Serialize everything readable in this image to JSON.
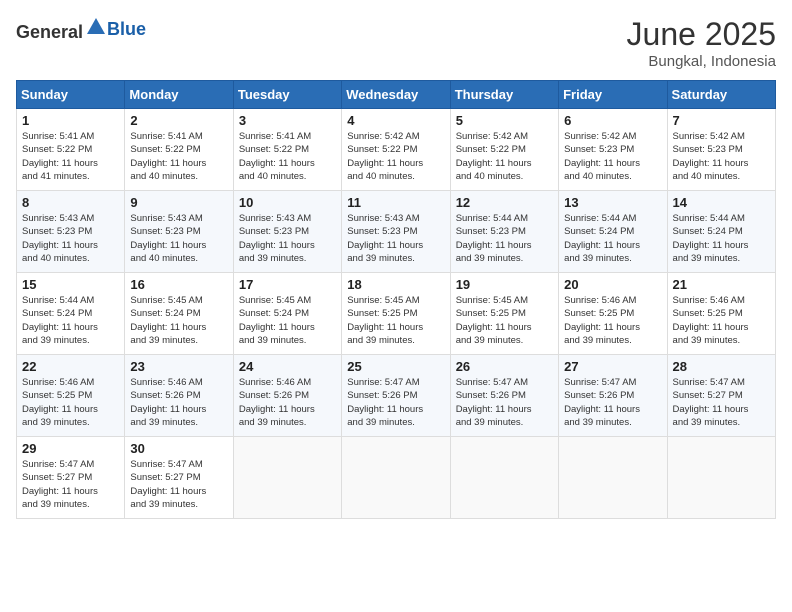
{
  "logo": {
    "general": "General",
    "blue": "Blue"
  },
  "title": "June 2025",
  "subtitle": "Bungkal, Indonesia",
  "headers": [
    "Sunday",
    "Monday",
    "Tuesday",
    "Wednesday",
    "Thursday",
    "Friday",
    "Saturday"
  ],
  "weeks": [
    [
      {
        "day": "1",
        "info": "Sunrise: 5:41 AM\nSunset: 5:22 PM\nDaylight: 11 hours\nand 41 minutes."
      },
      {
        "day": "2",
        "info": "Sunrise: 5:41 AM\nSunset: 5:22 PM\nDaylight: 11 hours\nand 40 minutes."
      },
      {
        "day": "3",
        "info": "Sunrise: 5:41 AM\nSunset: 5:22 PM\nDaylight: 11 hours\nand 40 minutes."
      },
      {
        "day": "4",
        "info": "Sunrise: 5:42 AM\nSunset: 5:22 PM\nDaylight: 11 hours\nand 40 minutes."
      },
      {
        "day": "5",
        "info": "Sunrise: 5:42 AM\nSunset: 5:22 PM\nDaylight: 11 hours\nand 40 minutes."
      },
      {
        "day": "6",
        "info": "Sunrise: 5:42 AM\nSunset: 5:23 PM\nDaylight: 11 hours\nand 40 minutes."
      },
      {
        "day": "7",
        "info": "Sunrise: 5:42 AM\nSunset: 5:23 PM\nDaylight: 11 hours\nand 40 minutes."
      }
    ],
    [
      {
        "day": "8",
        "info": "Sunrise: 5:43 AM\nSunset: 5:23 PM\nDaylight: 11 hours\nand 40 minutes."
      },
      {
        "day": "9",
        "info": "Sunrise: 5:43 AM\nSunset: 5:23 PM\nDaylight: 11 hours\nand 40 minutes."
      },
      {
        "day": "10",
        "info": "Sunrise: 5:43 AM\nSunset: 5:23 PM\nDaylight: 11 hours\nand 39 minutes."
      },
      {
        "day": "11",
        "info": "Sunrise: 5:43 AM\nSunset: 5:23 PM\nDaylight: 11 hours\nand 39 minutes."
      },
      {
        "day": "12",
        "info": "Sunrise: 5:44 AM\nSunset: 5:23 PM\nDaylight: 11 hours\nand 39 minutes."
      },
      {
        "day": "13",
        "info": "Sunrise: 5:44 AM\nSunset: 5:24 PM\nDaylight: 11 hours\nand 39 minutes."
      },
      {
        "day": "14",
        "info": "Sunrise: 5:44 AM\nSunset: 5:24 PM\nDaylight: 11 hours\nand 39 minutes."
      }
    ],
    [
      {
        "day": "15",
        "info": "Sunrise: 5:44 AM\nSunset: 5:24 PM\nDaylight: 11 hours\nand 39 minutes."
      },
      {
        "day": "16",
        "info": "Sunrise: 5:45 AM\nSunset: 5:24 PM\nDaylight: 11 hours\nand 39 minutes."
      },
      {
        "day": "17",
        "info": "Sunrise: 5:45 AM\nSunset: 5:24 PM\nDaylight: 11 hours\nand 39 minutes."
      },
      {
        "day": "18",
        "info": "Sunrise: 5:45 AM\nSunset: 5:25 PM\nDaylight: 11 hours\nand 39 minutes."
      },
      {
        "day": "19",
        "info": "Sunrise: 5:45 AM\nSunset: 5:25 PM\nDaylight: 11 hours\nand 39 minutes."
      },
      {
        "day": "20",
        "info": "Sunrise: 5:46 AM\nSunset: 5:25 PM\nDaylight: 11 hours\nand 39 minutes."
      },
      {
        "day": "21",
        "info": "Sunrise: 5:46 AM\nSunset: 5:25 PM\nDaylight: 11 hours\nand 39 minutes."
      }
    ],
    [
      {
        "day": "22",
        "info": "Sunrise: 5:46 AM\nSunset: 5:25 PM\nDaylight: 11 hours\nand 39 minutes."
      },
      {
        "day": "23",
        "info": "Sunrise: 5:46 AM\nSunset: 5:26 PM\nDaylight: 11 hours\nand 39 minutes."
      },
      {
        "day": "24",
        "info": "Sunrise: 5:46 AM\nSunset: 5:26 PM\nDaylight: 11 hours\nand 39 minutes."
      },
      {
        "day": "25",
        "info": "Sunrise: 5:47 AM\nSunset: 5:26 PM\nDaylight: 11 hours\nand 39 minutes."
      },
      {
        "day": "26",
        "info": "Sunrise: 5:47 AM\nSunset: 5:26 PM\nDaylight: 11 hours\nand 39 minutes."
      },
      {
        "day": "27",
        "info": "Sunrise: 5:47 AM\nSunset: 5:26 PM\nDaylight: 11 hours\nand 39 minutes."
      },
      {
        "day": "28",
        "info": "Sunrise: 5:47 AM\nSunset: 5:27 PM\nDaylight: 11 hours\nand 39 minutes."
      }
    ],
    [
      {
        "day": "29",
        "info": "Sunrise: 5:47 AM\nSunset: 5:27 PM\nDaylight: 11 hours\nand 39 minutes."
      },
      {
        "day": "30",
        "info": "Sunrise: 5:47 AM\nSunset: 5:27 PM\nDaylight: 11 hours\nand 39 minutes."
      },
      {
        "day": "",
        "info": ""
      },
      {
        "day": "",
        "info": ""
      },
      {
        "day": "",
        "info": ""
      },
      {
        "day": "",
        "info": ""
      },
      {
        "day": "",
        "info": ""
      }
    ]
  ]
}
